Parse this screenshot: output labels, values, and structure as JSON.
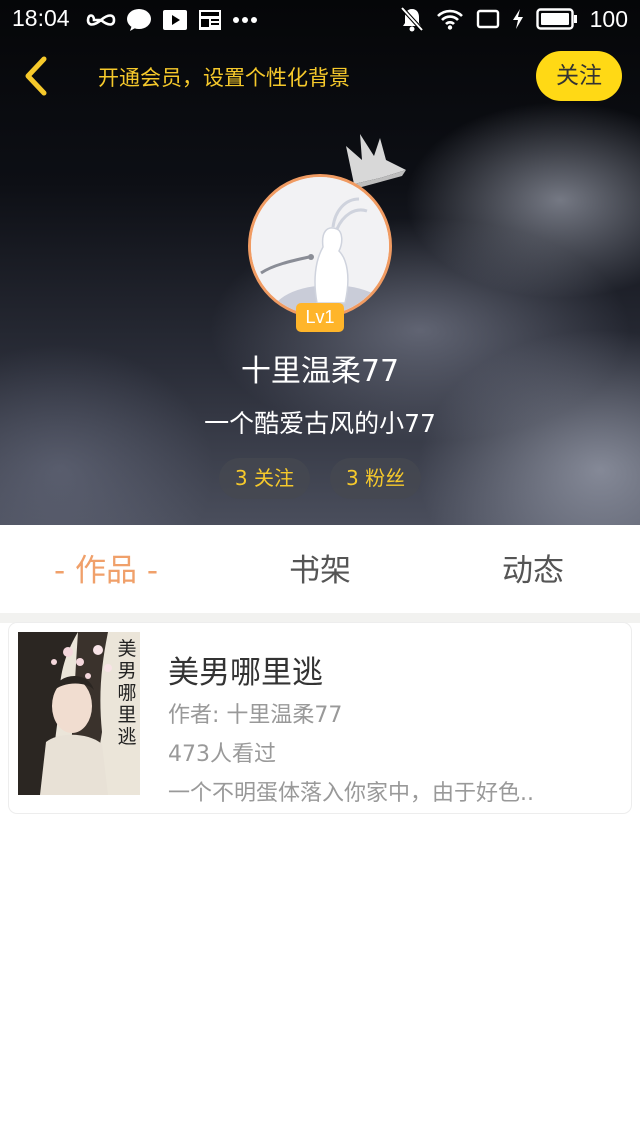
{
  "status_bar": {
    "time": "18:04",
    "battery": "100",
    "left_icons": [
      "infinity-icon",
      "chat-bubble-icon",
      "play-icon",
      "news-icon",
      "more-dots-icon"
    ],
    "right_icons": [
      "mute-icon",
      "wifi-icon",
      "screen-rotate-icon",
      "charging-icon",
      "battery-icon"
    ]
  },
  "header": {
    "vip_prompt": "开通会员，设置个性化背景",
    "follow_label": "关注",
    "accent_color": "#ffd915"
  },
  "profile": {
    "level": "Lv1",
    "username": "十里温柔77",
    "signature": "一个酷爱古风的小77",
    "following": "3 关注",
    "followers": "3 粉丝"
  },
  "tabs": [
    {
      "label": "- 作品 -",
      "active": true
    },
    {
      "label": "书架",
      "active": false
    },
    {
      "label": "动态",
      "active": false
    }
  ],
  "works": [
    {
      "cover_text": "美男哪里逃",
      "title": "美男哪里逃",
      "author": "作者: 十里温柔77",
      "views": "473人看过",
      "description": "一个不明蛋体落入你家中，由于好色.."
    }
  ]
}
